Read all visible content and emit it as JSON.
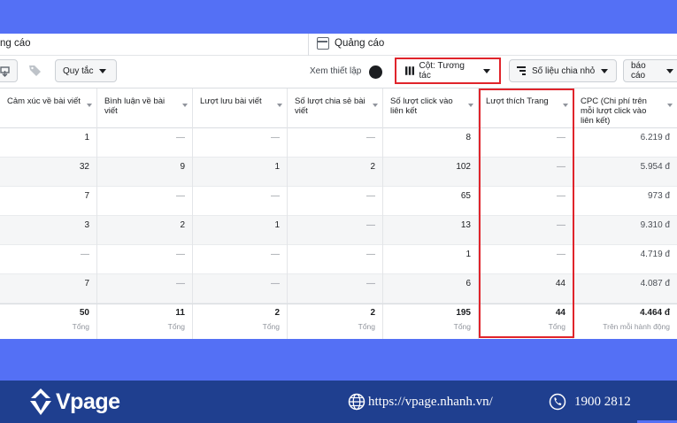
{
  "breadcrumb": {
    "left": "ng cáo",
    "right": "Quảng cáo"
  },
  "toolbar": {
    "rules_label": "Quy tắc",
    "view_setting_label": "Xem thiết lập",
    "columns_label": "Cột: Tương tác",
    "breakdown_label": "Số liệu chia nhỏ",
    "report_label": "báo cáo"
  },
  "table": {
    "columns": [
      "Cảm xúc về bài viết",
      "Bình luận về bài viết",
      "Lượt lưu bài viết",
      "Số lượt chia sẻ bài viết",
      "Số lượt click vào liên kết",
      "Lượt thích Trang",
      "CPC (Chi phí trên mỗi lượt click vào liên kết)"
    ],
    "rows": [
      [
        "1",
        "—",
        "—",
        "—",
        "8",
        "—",
        "6.219 đ"
      ],
      [
        "32",
        "9",
        "1",
        "2",
        "102",
        "—",
        "5.954 đ"
      ],
      [
        "7",
        "—",
        "—",
        "—",
        "65",
        "—",
        "973 đ"
      ],
      [
        "3",
        "2",
        "1",
        "—",
        "13",
        "—",
        "9.310 đ"
      ],
      [
        "—",
        "—",
        "—",
        "—",
        "1",
        "—",
        "4.719 đ"
      ],
      [
        "7",
        "—",
        "—",
        "—",
        "6",
        "44",
        "4.087 đ"
      ]
    ],
    "totals": [
      "50",
      "11",
      "2",
      "2",
      "195",
      "44",
      "4.464 đ"
    ],
    "total_sublabels": [
      "Tổng",
      "Tổng",
      "Tổng",
      "Tổng",
      "Tổng",
      "Tổng",
      "Trên mỗi hành động"
    ]
  },
  "footer": {
    "brand": "Vpage",
    "website": "https://vpage.nhanh.vn/",
    "phone": "1900 2812"
  },
  "colors": {
    "accent_red": "#e0242b",
    "banner_blue": "#5470f5",
    "footer_navy": "#1f3f8f"
  }
}
